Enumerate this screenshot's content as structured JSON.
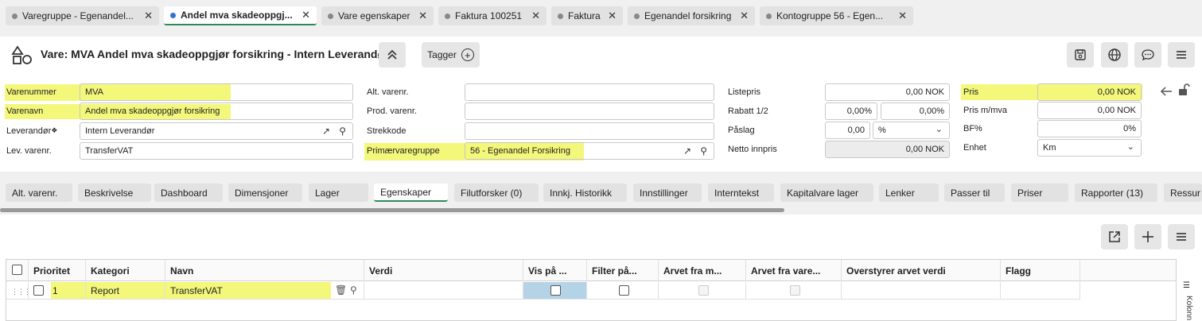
{
  "tabs": [
    {
      "label": "Varegruppe - Egenandel..."
    },
    {
      "label": "Andel mva skadeoppgj..."
    },
    {
      "label": "Vare egenskaper"
    },
    {
      "label": "Faktura 100251"
    },
    {
      "label": "Faktura"
    },
    {
      "label": "Egenandel forsikring"
    },
    {
      "label": "Kontogruppe 56 - Egen..."
    }
  ],
  "header": {
    "title": "Vare: MVA Andel mva skadeoppgjør forsikring - Intern Leverandør",
    "tag_label": "Tagger"
  },
  "form": {
    "varenummer_label": "Varenummer",
    "varenummer": "MVA",
    "varenavn_label": "Varenavn",
    "varenavn": "Andel mva skadeoppgjør forsikring",
    "leverandor_label": "Leverandør",
    "leverandor": "Intern Leverandør",
    "lev_varenr_label": "Lev. varenr.",
    "lev_varenr": "TransferVAT",
    "alt_varenr_label": "Alt. varenr.",
    "alt_varenr": "",
    "prod_varenr_label": "Prod. varenr.",
    "prod_varenr": "",
    "strekkode_label": "Strekkode",
    "strekkode": "",
    "primaervaregruppe_label": "Primærvaregruppe",
    "primaervaregruppe": "56 - Egenandel Forsikring",
    "listepris_label": "Listepris",
    "listepris": "0,00 NOK",
    "rabatt_label": "Rabatt 1/2",
    "rabatt1": "0,00%",
    "rabatt2": "0,00%",
    "paslag_label": "Påslag",
    "paslag": "0,00",
    "paslag_unit": "%",
    "netto_label": "Netto innpris",
    "netto": "0,00 NOK",
    "pris_label": "Pris",
    "pris": "0,00 NOK",
    "pris_mva_label": "Pris m/mva",
    "pris_mva": "0,00 NOK",
    "bf_label": "BF%",
    "bf": "0%",
    "enhet_label": "Enhet",
    "enhet": "Km"
  },
  "subtabs": [
    {
      "label": "Alt. varenr."
    },
    {
      "label": "Beskrivelse"
    },
    {
      "label": "Dashboard"
    },
    {
      "label": "Dimensjoner"
    },
    {
      "label": "Lager"
    },
    {
      "label": "Egenskaper"
    },
    {
      "label": "Filutforsker (0)"
    },
    {
      "label": "Innkj. Historikk"
    },
    {
      "label": "Innstillinger"
    },
    {
      "label": "Interntekst"
    },
    {
      "label": "Kapitalvare lager"
    },
    {
      "label": "Lenker"
    },
    {
      "label": "Passer til"
    },
    {
      "label": "Priser"
    },
    {
      "label": "Rapporter (13)"
    },
    {
      "label": "Ressur"
    }
  ],
  "grid": {
    "columns": [
      "Prioritet",
      "Kategori",
      "Navn",
      "Verdi",
      "Vis på ...",
      "Filter på...",
      "Arvet fra m...",
      "Arvet fra vare...",
      "Overstyrer arvet verdi",
      "Flagg"
    ],
    "rows": [
      {
        "prioritet": "1",
        "kategori": "Report",
        "navn": "TransferVAT",
        "verdi": ""
      }
    ],
    "side_label": "Kolonn"
  }
}
